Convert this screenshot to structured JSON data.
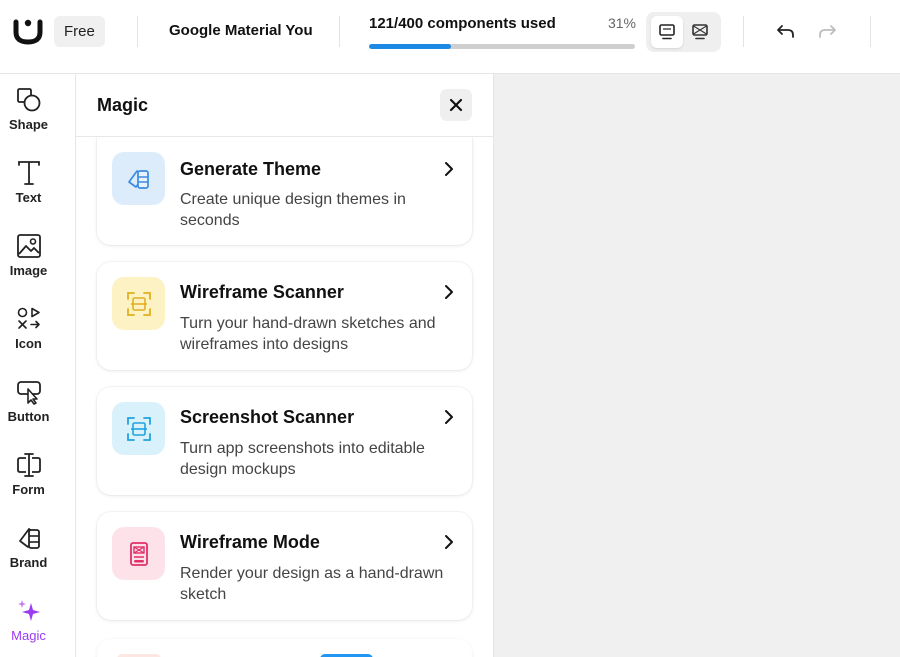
{
  "topbar": {
    "plan": "Free",
    "project_name": "Google Material You",
    "usage_text": "121/400 components used",
    "usage_percent_label": "31%",
    "usage_fraction": 0.31,
    "accent_color": "#1e88e5"
  },
  "rail": {
    "items": [
      {
        "label": "Shape",
        "icon": "shape-icon"
      },
      {
        "label": "Text",
        "icon": "text-icon"
      },
      {
        "label": "Image",
        "icon": "image-icon"
      },
      {
        "label": "Icon",
        "icon": "icons-icon"
      },
      {
        "label": "Button",
        "icon": "button-icon"
      },
      {
        "label": "Form",
        "icon": "form-icon"
      },
      {
        "label": "Brand",
        "icon": "brand-icon"
      },
      {
        "label": "Magic",
        "icon": "magic-sparkle-icon"
      }
    ],
    "active_color": "#9b3cf0"
  },
  "panel": {
    "title": "Magic",
    "cards": [
      {
        "title": "Generate Theme",
        "description": "Create unique design themes in seconds",
        "icon": "theme-palette-icon",
        "icon_bg": "#dcecfb",
        "icon_color": "#3d8be0"
      },
      {
        "title": "Wireframe Scanner",
        "description": "Turn your hand-drawn sketches and wireframes into designs",
        "icon": "wireframe-scan-icon",
        "icon_bg": "#fdf2c4",
        "icon_color": "#e0b020"
      },
      {
        "title": "Screenshot Scanner",
        "description": "Turn app screenshots into editable design mockups",
        "icon": "screenshot-scan-icon",
        "icon_bg": "#d9f1fb",
        "icon_color": "#1fa3e0"
      },
      {
        "title": "Wireframe Mode",
        "description": "Render your design as a hand-drawn sketch",
        "icon": "wireframe-mode-icon",
        "icon_bg": "#fde2ea",
        "icon_color": "#e0306a"
      }
    ]
  }
}
